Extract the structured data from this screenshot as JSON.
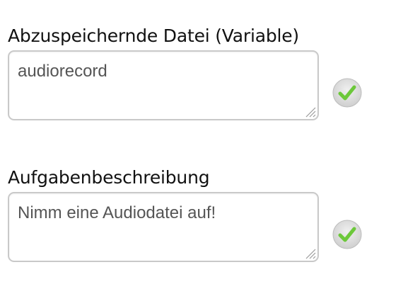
{
  "fields": [
    {
      "label": "Abzuspeichernde Datei (Variable)",
      "value": "audiorecord",
      "status_icon": "check-icon"
    },
    {
      "label": "Aufgabenbeschreibung",
      "value": "Nimm eine Audiodatei auf!",
      "status_icon": "check-icon"
    }
  ],
  "colors": {
    "check_green": "#6cc83a",
    "badge_bg": "#d9d9d9",
    "border": "#c9c9c9",
    "text_value": "#555555"
  }
}
